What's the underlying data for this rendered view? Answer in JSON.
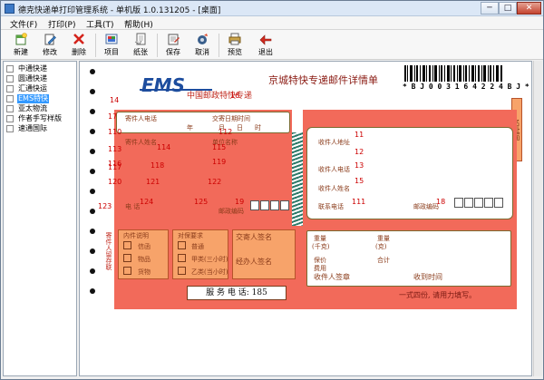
{
  "window": {
    "title": "德克快递单打印管理系统 - 单机版 1.0.131205 - [桌面]",
    "controls": {
      "minimize": "─",
      "maximize": "□",
      "close": "✕"
    }
  },
  "menu": {
    "items": [
      "文件(F)",
      "打印(P)",
      "工具(T)",
      "帮助(H)"
    ]
  },
  "toolbar": {
    "buttons": [
      {
        "label": "新建",
        "icon": "new-icon"
      },
      {
        "label": "修改",
        "icon": "edit-icon"
      },
      {
        "label": "删除",
        "icon": "delete-icon"
      },
      {
        "label": "项目",
        "icon": "project-icon"
      },
      {
        "label": "纸张",
        "icon": "paper-icon"
      },
      {
        "label": "保存",
        "icon": "save-icon"
      },
      {
        "label": "取消",
        "icon": "cancel-icon"
      },
      {
        "label": "预览",
        "icon": "preview-icon"
      },
      {
        "label": "退出",
        "icon": "exit-icon"
      }
    ]
  },
  "tree": {
    "items": [
      {
        "label": "中通快递",
        "selected": false
      },
      {
        "label": "圆通快递",
        "selected": false
      },
      {
        "label": "汇通快运",
        "selected": false
      },
      {
        "label": "EMS特快",
        "selected": true
      },
      {
        "label": "亚太物流",
        "selected": false
      },
      {
        "label": "作者手写样版",
        "selected": false
      },
      {
        "label": "速通国际",
        "selected": false
      }
    ]
  },
  "form": {
    "logo": "EMS",
    "logo_sub": "中国邮政特快专递",
    "title": "京城特快专递邮件详情单",
    "barcode_text": "* B J 0 0 3 1 6 4 2 2 4 B J *",
    "side_label": "名址面",
    "labels": {
      "sender_phone": "寄件人电话",
      "send_date": "交寄日期时间",
      "date_parts": [
        "年",
        "月",
        "日",
        "时"
      ],
      "sender_name": "寄件人姓名",
      "sender_company": "单位名称",
      "sender_address": "寄件人地址",
      "phone": "电 话",
      "postcode": "邮政编码",
      "receiver_address": "收件人地址",
      "receiver_phone": "收件人电话",
      "receiver_name": "收件人姓名",
      "contact_phone": "联系电话",
      "receiver_postcode": "邮政编码",
      "contents": "内件说明",
      "doc": "信函",
      "item": "物品",
      "goods": "货物",
      "service": "对保要求",
      "normal": "普通",
      "a_class": "甲类(三小时)",
      "b_class": "乙类(当小时)",
      "sender_sign": "交寄人签名",
      "handler_sign": "经办人签名",
      "weight": "重量",
      "cost": "费用",
      "insurance": "保价",
      "total": "合计",
      "receiver_sign": "收件人签章",
      "receive_time": "收到时间",
      "service_phone": "服 务 电 话: 185",
      "footer": "一式四份, 请用力填写。",
      "side_cn": "寄件人留存联",
      "unit_kg": "(千克)",
      "unit_g": "(克)"
    },
    "field_numbers": [
      "14",
      "16",
      "17",
      "110",
      "112",
      "113",
      "114",
      "115",
      "116",
      "117",
      "118",
      "119",
      "120",
      "121",
      "122",
      "123",
      "124",
      "125",
      "19",
      "11",
      "12",
      "13",
      "15",
      "111",
      "18"
    ]
  },
  "colors": {
    "form_red": "#f26a5a",
    "form_orange": "#f7a36a",
    "label_brown": "#8a3b1a",
    "field_red": "#cc0000",
    "ems_blue": "#1d4d9e",
    "selected": "#3399ff"
  }
}
